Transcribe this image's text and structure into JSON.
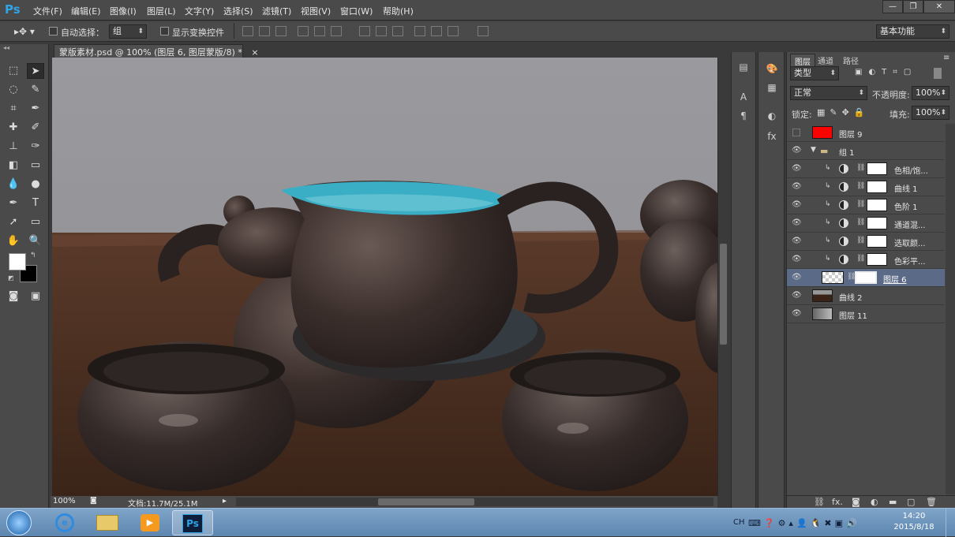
{
  "app": {
    "logo": "Ps"
  },
  "menu": [
    "文件(F)",
    "编辑(E)",
    "图像(I)",
    "图层(L)",
    "文字(Y)",
    "选择(S)",
    "滤镜(T)",
    "视图(V)",
    "窗口(W)",
    "帮助(H)"
  ],
  "window_controls": {
    "minimize": "—",
    "restore": "❐",
    "close": "✕"
  },
  "options": {
    "auto_select_label": "自动选择：",
    "auto_select_value": "组",
    "show_transform_label": "显示变换控件",
    "workspace": "基本功能"
  },
  "document": {
    "tab_title": "蒙版素材.psd @ 100% (图层 6, 图层蒙版/8) *",
    "tab_close": "×",
    "zoom": "100%",
    "doc_info": "文档:11.7M/25.1M"
  },
  "layers_panel": {
    "tabs": [
      "图层",
      "通道",
      "路径"
    ],
    "filter_kind": "类型",
    "blend_mode": "正常",
    "opacity_label": "不透明度:",
    "opacity_value": "100%",
    "lock_label": "锁定:",
    "fill_label": "填充:",
    "fill_value": "100%",
    "layers": [
      {
        "name": "图层 9",
        "visible": false,
        "thumb": "red"
      },
      {
        "name": "组 1",
        "visible": true,
        "type": "group"
      },
      {
        "name": "色相/饱...",
        "visible": true,
        "type": "adjustment",
        "clipped": true
      },
      {
        "name": "曲线 1",
        "visible": true,
        "type": "adjustment",
        "clipped": true
      },
      {
        "name": "色阶 1",
        "visible": true,
        "type": "adjustment",
        "clipped": true
      },
      {
        "name": "通道混...",
        "visible": true,
        "type": "adjustment",
        "clipped": true
      },
      {
        "name": "选取颜...",
        "visible": true,
        "type": "adjustment",
        "clipped": true
      },
      {
        "name": "色彩平...",
        "visible": true,
        "type": "adjustment",
        "clipped": true
      },
      {
        "name": "图层 6",
        "visible": true,
        "type": "masked",
        "selected": true
      },
      {
        "name": "曲线 2",
        "visible": true,
        "type": "image"
      },
      {
        "name": "图层 11",
        "visible": true,
        "type": "gradient"
      }
    ],
    "footer_icons": [
      "link-icon",
      "fx-icon",
      "mask-icon",
      "adjustment-icon",
      "folder-icon",
      "new-layer-icon",
      "trash-icon"
    ],
    "footer_fx": "fx."
  },
  "taskbar": {
    "lang": "CH",
    "time": "14:20",
    "date": "2015/8/18"
  },
  "colors": {
    "selected_layer": "#5b6a86",
    "red_swatch": "#ff0000",
    "accent_ps": "#2fa4e7"
  }
}
